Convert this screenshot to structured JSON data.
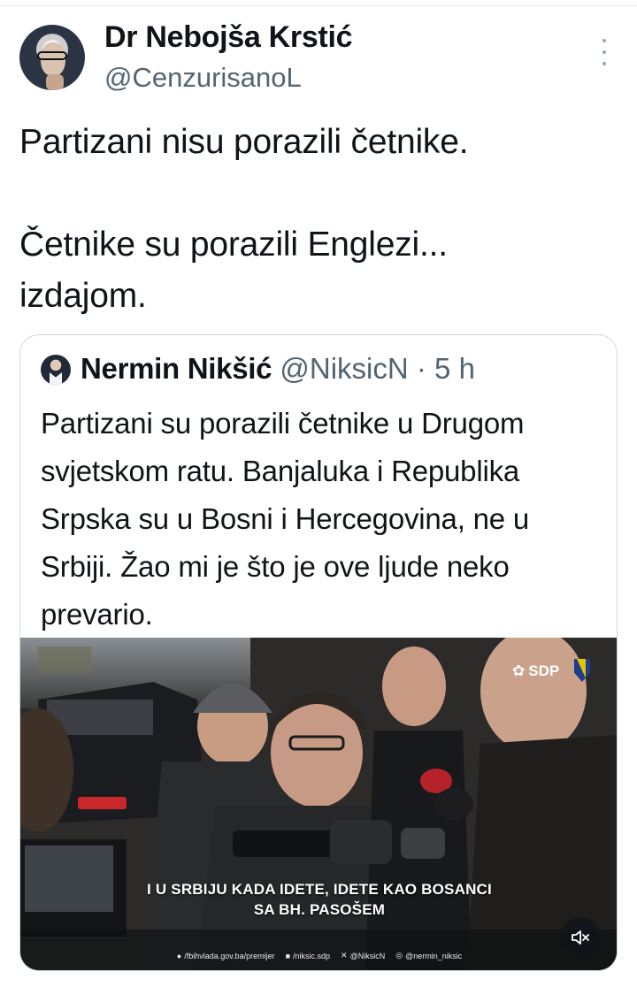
{
  "tweet": {
    "author_name": "Dr Nebojša Krstić",
    "author_handle": "@CenzurisanoL",
    "text": "Partizani nisu porazili četnike.\n\nČetnike su porazili Englezi...\nizdajom."
  },
  "quote": {
    "author_name": "Nermin Nikšić",
    "author_handle": "@NiksicN",
    "separator": "·",
    "time": "5 h",
    "text": "Partizani su porazili četnike u Drugom svjetskom ratu. Banjaluka i Republika Srpska su u Bosni i Hercegovina, ne u Srbiji. Žao mi je što je ove ljude neko prevario.",
    "media": {
      "logo_text": "SDP",
      "subtitle_line1": "I U SRBIJU KADA IDETE, IDETE KAO BOSANCI",
      "subtitle_line2": "SA BH. PASOŠEM",
      "socials": [
        {
          "icon": "globe-icon",
          "text": "/fbihvlada.gov.ba/premijer"
        },
        {
          "icon": "facebook-icon",
          "text": "/niksic.sdp"
        },
        {
          "icon": "x-icon",
          "text": "@NiksicN"
        },
        {
          "icon": "instagram-icon",
          "text": "@nermin_niksic"
        }
      ]
    }
  },
  "icons": {
    "more": "more-icon",
    "mute": "speaker-mute-icon"
  },
  "colors": {
    "text": "#0f1419",
    "secondary": "#536471",
    "border": "#cfd9de"
  }
}
